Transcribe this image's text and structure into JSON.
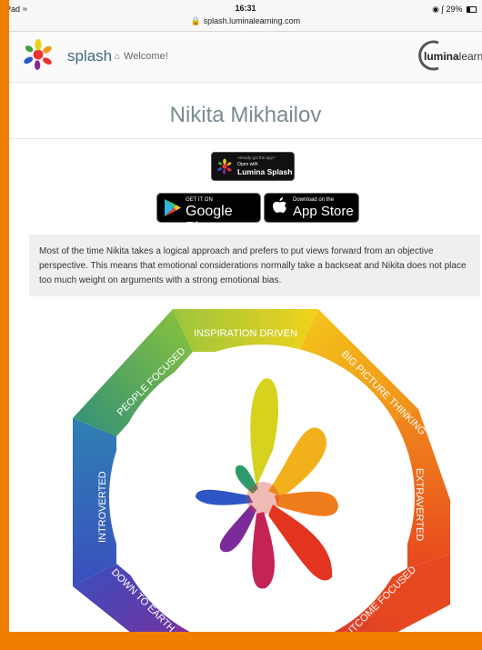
{
  "status_bar": {
    "device": "iPad",
    "time": "16:31",
    "url": "splash.luminalearning.com",
    "battery": "29%"
  },
  "header": {
    "brand": "splash",
    "welcome": "Welcome!",
    "partner_logo_strong": "lumina",
    "partner_logo_light": "learning"
  },
  "profile": {
    "name": "Nikita Mikhailov"
  },
  "app_badges": {
    "open_line1": "Already got the app?",
    "open_line2": "Open with",
    "open_line3": "Lumina Splash",
    "google_pre": "GET IT ON",
    "google_main": "Google Play",
    "apple_pre": "Download on the",
    "apple_main": "App Store"
  },
  "description": "Most of the time Nikita takes a logical approach and prefers to put views forward from an objective perspective. This means that emotional considerations normally take a backseat and Nikita does not place too much weight on arguments with a strong emotional bias.",
  "wheel_labels": {
    "top": "INSPIRATION DRIVEN",
    "top_right": "BIG PICTURE THINKING",
    "right": "EXTRAVERTED",
    "bottom_right": "OUTCOME FOCUSED",
    "bottom_left": "DOWN TO EARTH",
    "left": "INTROVERTED",
    "top_left": "PEOPLE FOCUSED"
  },
  "colors": {
    "brand_orange": "#f07f00",
    "brand_text": "#3d6a7e",
    "name_text": "#7b8b92"
  }
}
